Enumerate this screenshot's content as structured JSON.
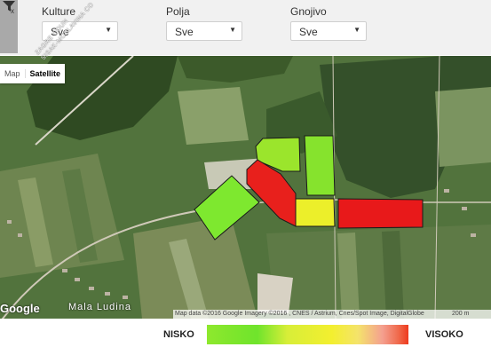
{
  "filters": [
    {
      "label": "Kulture",
      "value": "Sve"
    },
    {
      "label": "Polja",
      "value": "Sve"
    },
    {
      "label": "Gnojivo",
      "value": "Sve"
    }
  ],
  "map": {
    "type_buttons": {
      "map": "Map",
      "satellite": "Satellite"
    },
    "road_label_1": "ZAGRE COUN",
    "road_label_2": "SISAK-MOSLAVINA CO",
    "place_label": "Mala Ludina",
    "google_logo": "Google",
    "attribution": "Map data ©2016 Google Imagery ©2016 , CNES / Astrium, Cnes/Spot Image, DigitalGlobe",
    "scale_label": "200 m",
    "fields": [
      {
        "color": "#7ee82f"
      },
      {
        "color": "#9be52c"
      },
      {
        "color": "#86e32d"
      },
      {
        "color": "#e8201c"
      },
      {
        "color": "#ecef2a"
      },
      {
        "color": "#e8191a"
      }
    ]
  },
  "legend": {
    "low": "NISKO",
    "high": "VISOKO"
  }
}
